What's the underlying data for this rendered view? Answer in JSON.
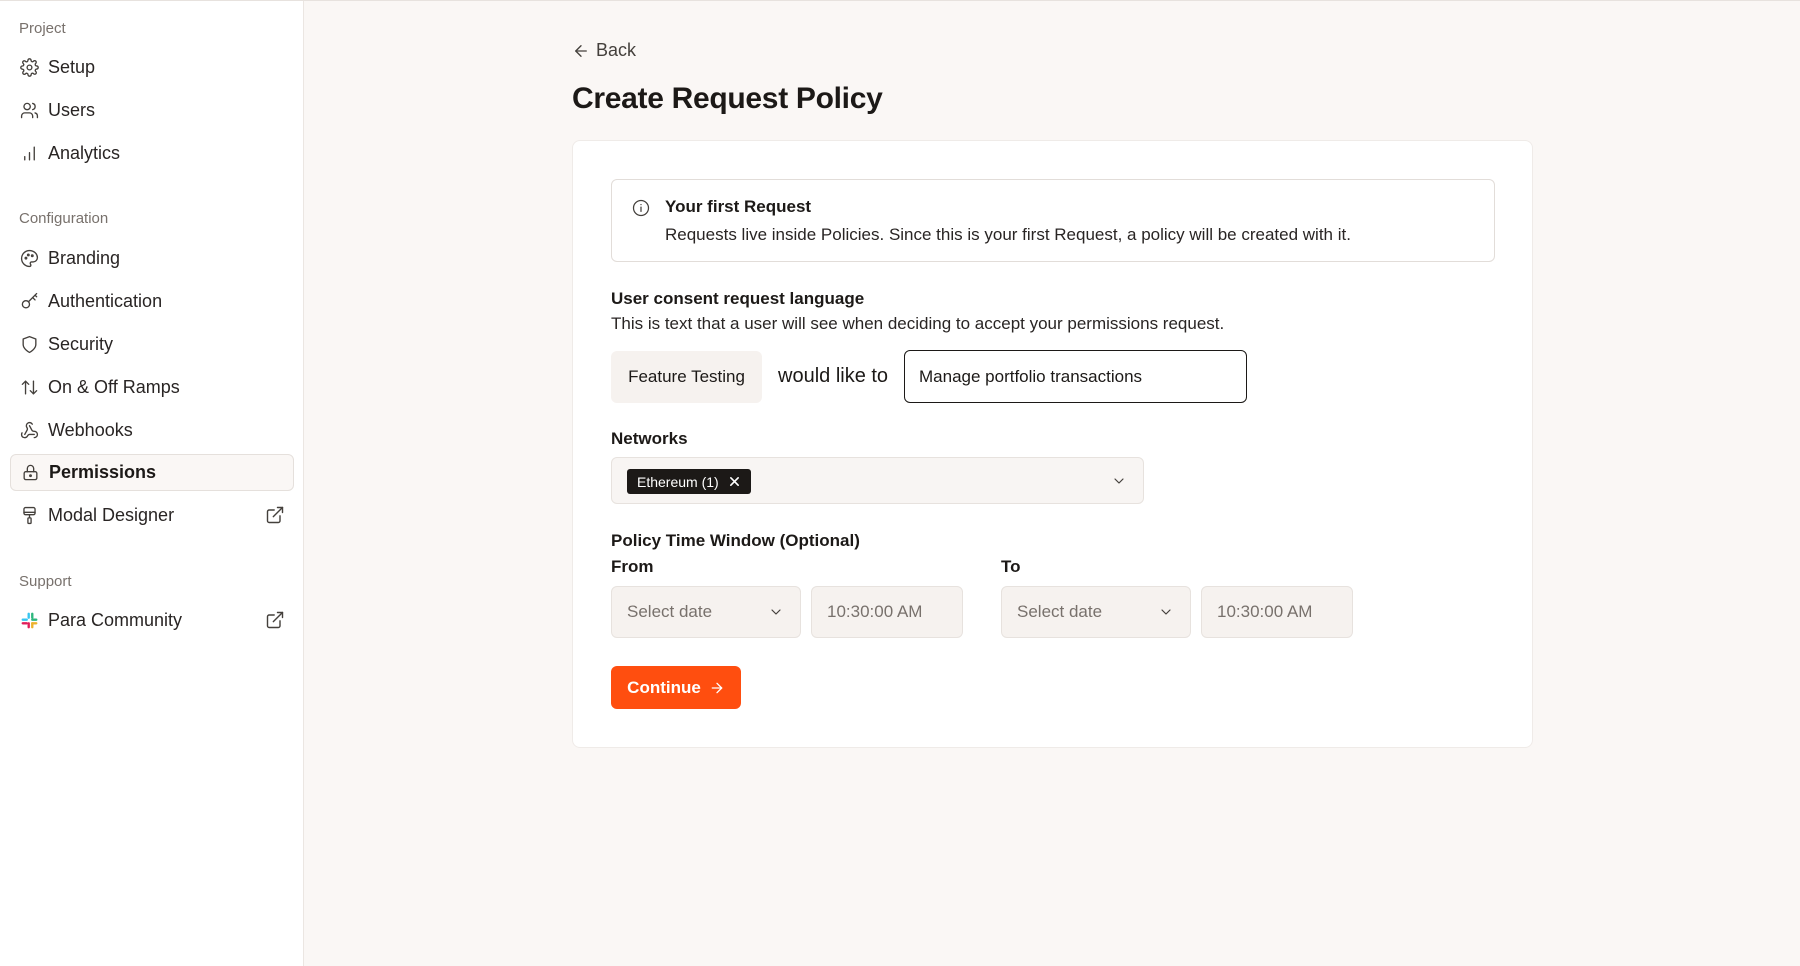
{
  "sidebar": {
    "sections": {
      "project": "Project",
      "configuration": "Configuration",
      "support": "Support"
    },
    "items": {
      "setup": "Setup",
      "users": "Users",
      "analytics": "Analytics",
      "branding": "Branding",
      "authentication": "Authentication",
      "security": "Security",
      "ramps": "On & Off Ramps",
      "webhooks": "Webhooks",
      "permissions": "Permissions",
      "modal_designer": "Modal Designer",
      "para_community": "Para Community"
    },
    "active_item": "Permissions"
  },
  "main": {
    "back_label": "Back",
    "title": "Create Request Policy",
    "info": {
      "title": "Your first Request",
      "text": "Requests live inside Policies. Since this is your first Request, a policy will be created with it."
    },
    "consent": {
      "label": "User consent request language",
      "helper": "This is text that a user will see when deciding to accept your permissions request.",
      "app_name": "Feature Testing",
      "connector": "would like to",
      "value": "Manage portfolio transactions"
    },
    "networks": {
      "label": "Networks",
      "selected": [
        "Ethereum (1)"
      ]
    },
    "time_window": {
      "label": "Policy Time Window (Optional)",
      "from_label": "From",
      "to_label": "To",
      "from_date_placeholder": "Select date",
      "from_time": "10:30:00 AM",
      "to_date_placeholder": "Select date",
      "to_time": "10:30:00 AM"
    },
    "continue_label": "Continue"
  },
  "colors": {
    "accent": "#ff4e0f",
    "background": "#faf7f5",
    "tag_bg": "#1c1917"
  }
}
